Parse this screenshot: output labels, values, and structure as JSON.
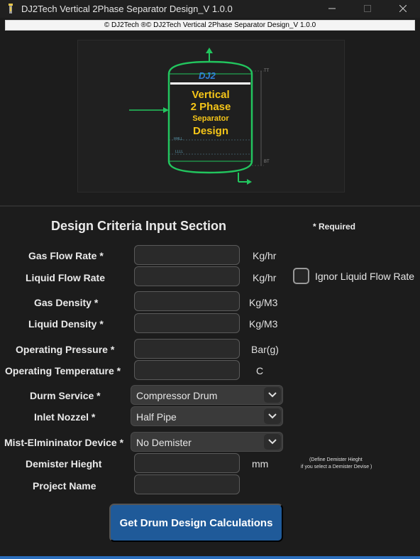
{
  "window": {
    "title": "DJ2Tech Vertical 2Phase Separator Design_V 1.0.0"
  },
  "banner": "© DJ2Tech ®©  DJ2Tech Vertical 2Phase Separator Design_V 1.0.0",
  "diagram": {
    "logo": "DJ2",
    "title_lines": [
      "Vertical",
      "2 Phase",
      "Separator",
      "Design"
    ],
    "tags": {
      "tt": "TT",
      "bt": "BT",
      "hhll": "HHLL",
      "llll": "LLLL"
    }
  },
  "form": {
    "section_title": "Design Criteria Input Section",
    "required_note": "* Required",
    "fields": {
      "gas_flow_rate": {
        "label": "Gas Flow Rate *",
        "value": "",
        "unit": "Kg/hr"
      },
      "liquid_flow_rate": {
        "label": "Liquid Flow Rate",
        "value": "",
        "unit": "Kg/hr"
      },
      "gas_density": {
        "label": "Gas Density *",
        "value": "",
        "unit": "Kg/M3"
      },
      "liquid_density": {
        "label": "Liquid Density *",
        "value": "",
        "unit": "Kg/M3"
      },
      "operating_pressure": {
        "label": "Operating Pressure *",
        "value": "",
        "unit": "Bar(g)"
      },
      "operating_temperature": {
        "label": "Operating Temperature *",
        "value": "",
        "unit": "C"
      },
      "demister_height": {
        "label": "Demister Hieght",
        "value": "",
        "unit": "mm"
      },
      "project_name": {
        "label": "Project Name",
        "value": ""
      }
    },
    "ignore_liquid": {
      "label": "Ignor Liquid Flow Rate",
      "checked": false
    },
    "drum_service": {
      "label": "Durm Service *",
      "selected": "Compressor Drum"
    },
    "inlet_nozzle": {
      "label": "Inlet Nozzel *",
      "selected": "Half Pipe"
    },
    "mist_device": {
      "label": "Mist-Elmininator Device *",
      "selected": "No Demister"
    },
    "demister_note": [
      "(Define Demister Hieght",
      "if you select a Demister Devise )"
    ],
    "submit_label": "Get Drum Design Calculations"
  },
  "colors": {
    "accent": "#1f5a99",
    "vessel_outline": "#22c55e",
    "diagram_text": "#f5c518",
    "logo": "#2f7fd8"
  }
}
